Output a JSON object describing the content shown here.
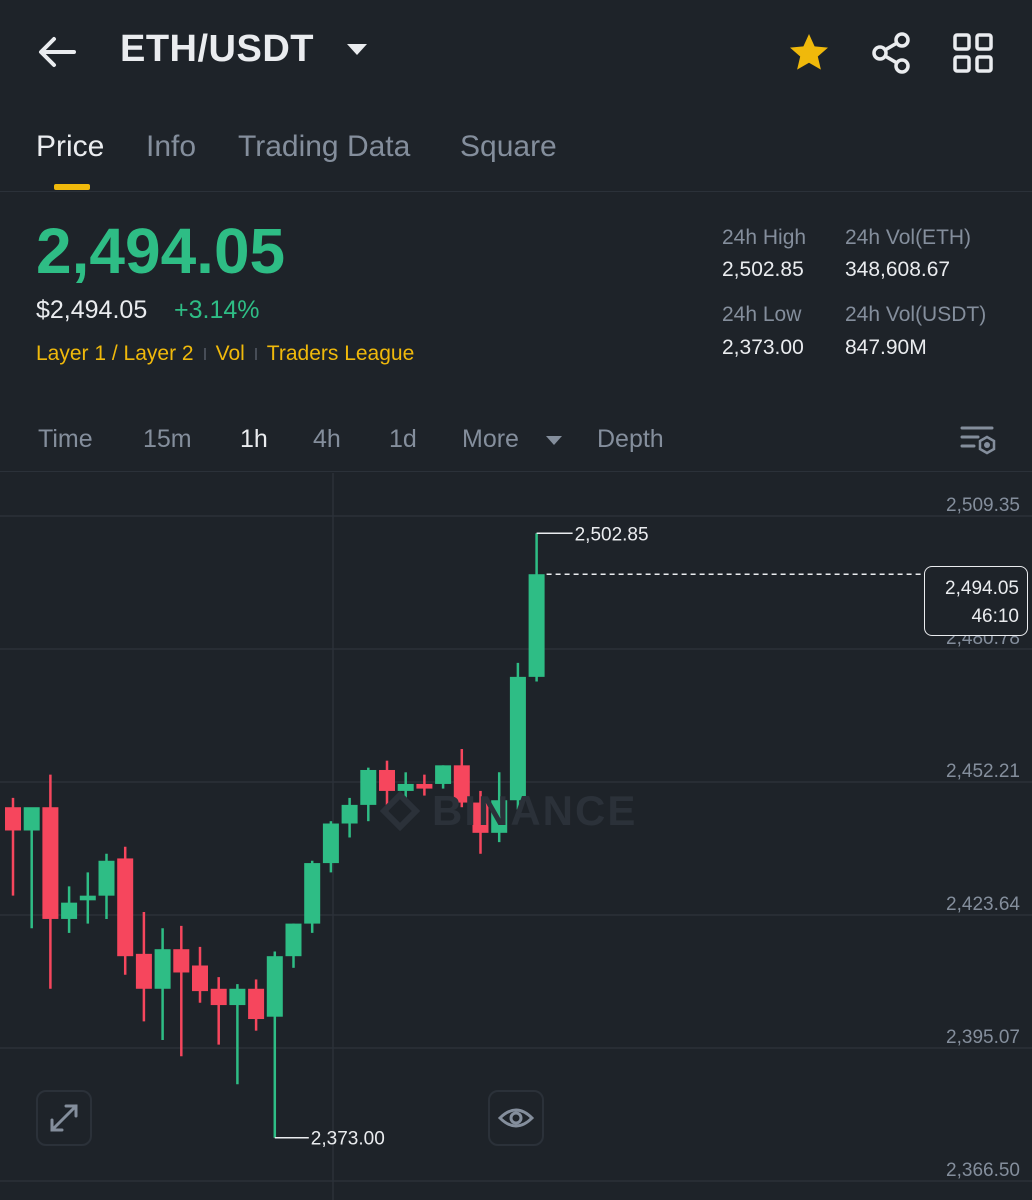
{
  "header": {
    "pair": "ETH/USDT",
    "icons": [
      "back-arrow-icon",
      "caret-down-icon",
      "star-icon",
      "share-icon",
      "grid-icon"
    ],
    "star_color": "#f0b90b"
  },
  "tabs": [
    {
      "label": "Price",
      "active": true
    },
    {
      "label": "Info",
      "active": false
    },
    {
      "label": "Trading Data",
      "active": false
    },
    {
      "label": "Square",
      "active": false
    }
  ],
  "price": {
    "last": "2,494.05",
    "usd": "$2,494.05",
    "change": "+3.14%",
    "tags": [
      "Layer 1 / Layer 2",
      "Vol",
      "Traders League"
    ]
  },
  "stats": {
    "high_label": "24h High",
    "high": "2,502.85",
    "vol_eth_label": "24h Vol(ETH)",
    "vol_eth": "348,608.67",
    "low_label": "24h Low",
    "low": "2,373.00",
    "vol_usdt_label": "24h Vol(USDT)",
    "vol_usdt": "847.90M"
  },
  "timeframes": {
    "items": [
      "Time",
      "15m",
      "1h",
      "4h",
      "1d",
      "More",
      "Depth"
    ],
    "active": "1h"
  },
  "colors": {
    "up": "#2ebd85",
    "down": "#f6465d",
    "accent": "#f0b90b",
    "background": "#1e2329"
  },
  "chart": {
    "watermark": "BINANCE",
    "y_ticks": [
      "2,509.35",
      "2,480.78",
      "2,452.21",
      "2,423.64",
      "2,395.07",
      "2,366.50"
    ],
    "high_marker": "2,502.85",
    "low_marker": "2,373.00",
    "last_price": "2,494.05",
    "countdown": "46:10"
  },
  "chart_data": {
    "type": "candlestick",
    "interval": "1h",
    "y_ticks": [
      2509.35,
      2480.78,
      2452.21,
      2423.64,
      2395.07,
      2366.5
    ],
    "ylim": [
      2366.5,
      2509.35
    ],
    "grid": true,
    "candles": [
      {
        "o": 2444.0,
        "h": 2446.0,
        "l": 2425.0,
        "c": 2439.0
      },
      {
        "o": 2439.0,
        "h": 2441.0,
        "l": 2418.0,
        "c": 2444.0
      },
      {
        "o": 2444.0,
        "h": 2451.0,
        "l": 2405.0,
        "c": 2420.0
      },
      {
        "o": 2420.0,
        "h": 2427.0,
        "l": 2417.0,
        "c": 2423.5
      },
      {
        "o": 2424.0,
        "h": 2430.0,
        "l": 2419.0,
        "c": 2425.0
      },
      {
        "o": 2425.0,
        "h": 2434.0,
        "l": 2420.0,
        "c": 2432.5
      },
      {
        "o": 2433.0,
        "h": 2435.5,
        "l": 2408.0,
        "c": 2412.0
      },
      {
        "o": 2412.5,
        "h": 2421.5,
        "l": 2398.0,
        "c": 2405.0
      },
      {
        "o": 2405.0,
        "h": 2418.0,
        "l": 2394.0,
        "c": 2413.5
      },
      {
        "o": 2413.5,
        "h": 2418.5,
        "l": 2390.5,
        "c": 2408.5
      },
      {
        "o": 2410.0,
        "h": 2414.0,
        "l": 2402.0,
        "c": 2404.5
      },
      {
        "o": 2405.0,
        "h": 2407.5,
        "l": 2393.0,
        "c": 2401.5
      },
      {
        "o": 2401.5,
        "h": 2406.0,
        "l": 2384.5,
        "c": 2405.0
      },
      {
        "o": 2405.0,
        "h": 2407.0,
        "l": 2396.0,
        "c": 2398.5
      },
      {
        "o": 2399.0,
        "h": 2413.0,
        "l": 2373.0,
        "c": 2412.0
      },
      {
        "o": 2412.0,
        "h": 2419.0,
        "l": 2409.5,
        "c": 2419.0
      },
      {
        "o": 2419.0,
        "h": 2432.5,
        "l": 2417.0,
        "c": 2432.0
      },
      {
        "o": 2432.0,
        "h": 2441.0,
        "l": 2430.0,
        "c": 2440.5
      },
      {
        "o": 2440.5,
        "h": 2446.0,
        "l": 2437.5,
        "c": 2444.5
      },
      {
        "o": 2444.5,
        "h": 2452.5,
        "l": 2441.0,
        "c": 2452.0
      },
      {
        "o": 2452.0,
        "h": 2454.0,
        "l": 2443.0,
        "c": 2447.5
      },
      {
        "o": 2447.5,
        "h": 2451.5,
        "l": 2446.0,
        "c": 2449.0
      },
      {
        "o": 2449.0,
        "h": 2451.0,
        "l": 2446.5,
        "c": 2448.0
      },
      {
        "o": 2449.0,
        "h": 2453.0,
        "l": 2448.0,
        "c": 2453.0
      },
      {
        "o": 2453.0,
        "h": 2456.5,
        "l": 2444.0,
        "c": 2445.0
      },
      {
        "o": 2445.0,
        "h": 2447.5,
        "l": 2434.0,
        "c": 2438.5
      },
      {
        "o": 2438.5,
        "h": 2451.5,
        "l": 2436.5,
        "c": 2445.5
      },
      {
        "o": 2445.5,
        "h": 2475.0,
        "l": 2443.5,
        "c": 2472.0
      },
      {
        "o": 2472.0,
        "h": 2502.85,
        "l": 2471.0,
        "c": 2494.05
      }
    ]
  }
}
